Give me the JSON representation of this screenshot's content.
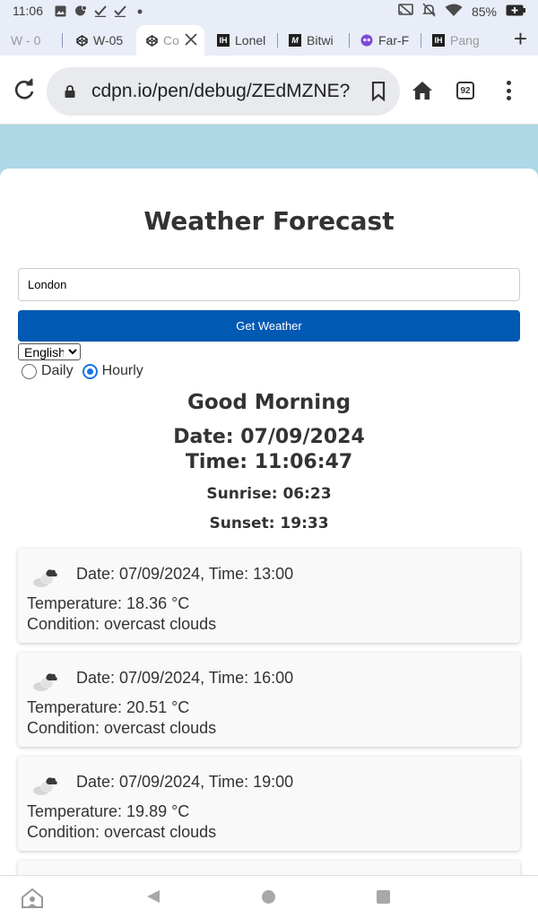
{
  "status_bar": {
    "time": "11:06",
    "battery": "85%",
    "left_icons": [
      "image-icon",
      "chat-icon",
      "check-icon",
      "check-icon",
      "dot-icon"
    ],
    "right_icons": [
      "cast-icon",
      "mute-icon",
      "wifi-icon",
      "battery-icon"
    ]
  },
  "tabs": [
    {
      "label": "W - 0",
      "favicon": "codepen-icon",
      "active": false
    },
    {
      "label": "W-05",
      "favicon": "codepen-icon",
      "active": false
    },
    {
      "label": "Co",
      "favicon": "codepen-icon",
      "active": true
    },
    {
      "label": "Lonel",
      "favicon": "ih-icon",
      "active": false
    },
    {
      "label": "Bitwi",
      "favicon": "m-icon",
      "active": false
    },
    {
      "label": "Far-F",
      "favicon": "face-icon",
      "active": false
    },
    {
      "label": "Pang",
      "favicon": "ih-icon",
      "active": false
    }
  ],
  "omnibox": {
    "url": "cdpn.io/pen/debug/ZEdMZNE?",
    "tab_count": "92"
  },
  "app": {
    "title": "Weather Forecast",
    "city_input_value": "London",
    "get_weather_label": "Get Weather",
    "language_selected": "English",
    "radio_daily": "Daily",
    "radio_hourly": "Hourly",
    "hourly_selected": true,
    "greeting": "Good Morning",
    "date_line": "Date: 07/09/2024",
    "time_line": "Time: 11:06:47",
    "sunrise": "Sunrise: 06:23",
    "sunset": "Sunset: 19:33"
  },
  "forecast": [
    {
      "when": "Date: 07/09/2024, Time: 13:00",
      "temperature": "Temperature: 18.36 °C",
      "condition": "Condition: overcast clouds",
      "icon": "overcast-clouds-icon"
    },
    {
      "when": "Date: 07/09/2024, Time: 16:00",
      "temperature": "Temperature: 20.51 °C",
      "condition": "Condition: overcast clouds",
      "icon": "overcast-clouds-icon"
    },
    {
      "when": "Date: 07/09/2024, Time: 19:00",
      "temperature": "Temperature: 19.89 °C",
      "condition": "Condition: overcast clouds",
      "icon": "overcast-clouds-icon"
    }
  ],
  "colors": {
    "page_background": "#add8e6",
    "button": "#0059b3",
    "chrome_strip": "#e9edf7"
  }
}
